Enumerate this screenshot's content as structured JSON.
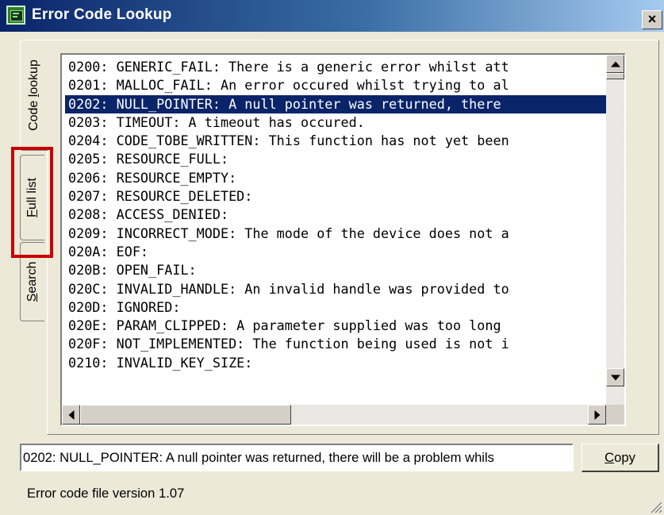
{
  "window": {
    "title": "Error Code Lookup",
    "close_glyph": "×"
  },
  "tabs": [
    {
      "label": "Code lookup",
      "mnemonic_index": 5
    },
    {
      "label": "Full list",
      "mnemonic_index": 0
    },
    {
      "label": "Search",
      "mnemonic_index": 0
    }
  ],
  "error_list": {
    "selected_index": 2,
    "items": [
      "0200: GENERIC_FAIL: There is a generic error whilst att",
      "0201: MALLOC_FAIL: An error occured whilst trying to al",
      "0202: NULL_POINTER: A null pointer was returned, there ",
      "0203: TIMEOUT: A timeout has occured.",
      "0204: CODE_TOBE_WRITTEN: This function has not yet been",
      "0205: RESOURCE_FULL:",
      "0206: RESOURCE_EMPTY:",
      "0207: RESOURCE_DELETED:",
      "0208: ACCESS_DENIED:",
      "0209: INCORRECT_MODE: The mode of the device does not a",
      "020A: EOF:",
      "020B: OPEN_FAIL:",
      "020C: INVALID_HANDLE: An invalid handle was provided to",
      "020D: IGNORED:",
      "020E: PARAM_CLIPPED: A parameter supplied was too long ",
      "020F: NOT_IMPLEMENTED: The function being used is not i",
      "0210: INVALID_KEY_SIZE:"
    ]
  },
  "detail_field": {
    "value": "0202: NULL_POINTER: A null pointer was returned, there will be a problem whils"
  },
  "copy_button": {
    "label": "Copy",
    "mnemonic_index": 0
  },
  "status_bar": {
    "text": "Error code file version 1.07"
  },
  "icons": {
    "app": "app-icon",
    "close": "close-icon",
    "scroll_up": "arrow-up-icon",
    "scroll_down": "arrow-down-icon",
    "scroll_left": "arrow-left-icon",
    "scroll_right": "arrow-right-icon",
    "grip": "resize-grip-icon"
  },
  "colors": {
    "selection": "#0a246a",
    "highlight_border": "#c80000",
    "titlebar_start": "#0a246a",
    "titlebar_end": "#a6caf0"
  }
}
